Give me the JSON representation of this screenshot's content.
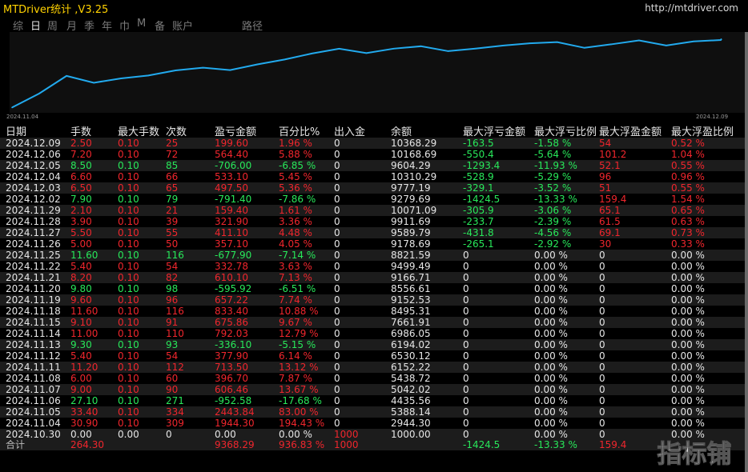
{
  "app": {
    "title": "MTDriver统计 ,V3.25",
    "url": "http://mtdriver.com"
  },
  "nav": {
    "items": [
      "综",
      "日",
      "周",
      "月",
      "季",
      "年",
      "巾",
      "M",
      "备",
      "账户",
      "路径"
    ],
    "active": "日"
  },
  "colors": {
    "profit": "#f0262d",
    "loss": "#28e85a",
    "curve": "#22aaee",
    "title": "#ffd200"
  },
  "chart_data": {
    "type": "line",
    "x_start_label": "2024.11.04",
    "x_end_label": "2024.12.09",
    "x": [
      "2024.10.30",
      "2024.11.04",
      "2024.11.05",
      "2024.11.06",
      "2024.11.07",
      "2024.11.08",
      "2024.11.11",
      "2024.11.12",
      "2024.11.13",
      "2024.11.14",
      "2024.11.15",
      "2024.11.18",
      "2024.11.19",
      "2024.11.20",
      "2024.11.21",
      "2024.11.22",
      "2024.11.25",
      "2024.11.26",
      "2024.11.27",
      "2024.11.28",
      "2024.11.29",
      "2024.12.02",
      "2024.12.03",
      "2024.12.04",
      "2024.12.05",
      "2024.12.06",
      "2024.12.09"
    ],
    "values": [
      1000.0,
      2944.3,
      5388.14,
      4435.56,
      5042.02,
      5438.72,
      6152.22,
      6530.12,
      6194.02,
      6986.05,
      7661.91,
      8495.31,
      9152.53,
      8556.61,
      9166.71,
      9499.49,
      8821.59,
      9178.69,
      9589.79,
      9911.69,
      10071.09,
      9279.69,
      9777.19,
      10310.29,
      9604.29,
      10168.69,
      10368.29
    ]
  },
  "table": {
    "headers": [
      "日期",
      "手数",
      "最大手数",
      "次数",
      "盈亏金额",
      "百分比%",
      "出入金",
      "余额",
      "最大浮亏金额",
      "最大浮亏比例",
      "最大浮盈金额",
      "最大浮盈比例"
    ],
    "rows": [
      [
        "2024.12.09",
        "2.50",
        "0.10",
        "25",
        "199.60",
        "1.96 %",
        "0",
        "10368.29",
        "-163.5",
        "-1.58 %",
        "54",
        "0.52 %"
      ],
      [
        "2024.12.06",
        "7.20",
        "0.10",
        "72",
        "564.40",
        "5.88 %",
        "0",
        "10168.69",
        "-550.4",
        "-5.64 %",
        "101.2",
        "1.04 %"
      ],
      [
        "2024.12.05",
        "8.50",
        "0.10",
        "85",
        "-706.00",
        "-6.85 %",
        "0",
        "9604.29",
        "-1293.4",
        "-11.93 %",
        "52.1",
        "0.55 %"
      ],
      [
        "2024.12.04",
        "6.60",
        "0.10",
        "66",
        "533.10",
        "5.45 %",
        "0",
        "10310.29",
        "-528.9",
        "-5.29 %",
        "96",
        "0.96 %"
      ],
      [
        "2024.12.03",
        "6.50",
        "0.10",
        "65",
        "497.50",
        "5.36 %",
        "0",
        "9777.19",
        "-329.1",
        "-3.52 %",
        "51",
        "0.55 %"
      ],
      [
        "2024.12.02",
        "7.90",
        "0.10",
        "79",
        "-791.40",
        "-7.86 %",
        "0",
        "9279.69",
        "-1424.5",
        "-13.33 %",
        "159.4",
        "1.54 %"
      ],
      [
        "2024.11.29",
        "2.10",
        "0.10",
        "21",
        "159.40",
        "1.61 %",
        "0",
        "10071.09",
        "-305.9",
        "-3.06 %",
        "65.1",
        "0.65 %"
      ],
      [
        "2024.11.28",
        "3.90",
        "0.10",
        "39",
        "321.90",
        "3.36 %",
        "0",
        "9911.69",
        "-233.7",
        "-2.39 %",
        "61.5",
        "0.63 %"
      ],
      [
        "2024.11.27",
        "5.50",
        "0.10",
        "55",
        "411.10",
        "4.48 %",
        "0",
        "9589.79",
        "-431.8",
        "-4.56 %",
        "69.1",
        "0.73 %"
      ],
      [
        "2024.11.26",
        "5.00",
        "0.10",
        "50",
        "357.10",
        "4.05 %",
        "0",
        "9178.69",
        "-265.1",
        "-2.92 %",
        "30",
        "0.33 %"
      ],
      [
        "2024.11.25",
        "11.60",
        "0.10",
        "116",
        "-677.90",
        "-7.14 %",
        "0",
        "8821.59",
        "0",
        "0.00 %",
        "0",
        "0.00 %"
      ],
      [
        "2024.11.22",
        "5.40",
        "0.10",
        "54",
        "332.78",
        "3.63 %",
        "0",
        "9499.49",
        "0",
        "0.00 %",
        "0",
        "0.00 %"
      ],
      [
        "2024.11.21",
        "8.20",
        "0.10",
        "82",
        "610.10",
        "7.13 %",
        "0",
        "9166.71",
        "0",
        "0.00 %",
        "0",
        "0.00 %"
      ],
      [
        "2024.11.20",
        "9.80",
        "0.10",
        "98",
        "-595.92",
        "-6.51 %",
        "0",
        "8556.61",
        "0",
        "0.00 %",
        "0",
        "0.00 %"
      ],
      [
        "2024.11.19",
        "9.60",
        "0.10",
        "96",
        "657.22",
        "7.74 %",
        "0",
        "9152.53",
        "0",
        "0.00 %",
        "0",
        "0.00 %"
      ],
      [
        "2024.11.18",
        "11.60",
        "0.10",
        "116",
        "833.40",
        "10.88 %",
        "0",
        "8495.31",
        "0",
        "0.00 %",
        "0",
        "0.00 %"
      ],
      [
        "2024.11.15",
        "9.10",
        "0.10",
        "91",
        "675.86",
        "9.67 %",
        "0",
        "7661.91",
        "0",
        "0.00 %",
        "0",
        "0.00 %"
      ],
      [
        "2024.11.14",
        "11.00",
        "0.10",
        "110",
        "792.03",
        "12.79 %",
        "0",
        "6986.05",
        "0",
        "0.00 %",
        "0",
        "0.00 %"
      ],
      [
        "2024.11.13",
        "9.30",
        "0.10",
        "93",
        "-336.10",
        "-5.15 %",
        "0",
        "6194.02",
        "0",
        "0.00 %",
        "0",
        "0.00 %"
      ],
      [
        "2024.11.12",
        "5.40",
        "0.10",
        "54",
        "377.90",
        "6.14 %",
        "0",
        "6530.12",
        "0",
        "0.00 %",
        "0",
        "0.00 %"
      ],
      [
        "2024.11.11",
        "11.20",
        "0.10",
        "112",
        "713.50",
        "13.12 %",
        "0",
        "6152.22",
        "0",
        "0.00 %",
        "0",
        "0.00 %"
      ],
      [
        "2024.11.08",
        "6.00",
        "0.10",
        "60",
        "396.70",
        "7.87 %",
        "0",
        "5438.72",
        "0",
        "0.00 %",
        "0",
        "0.00 %"
      ],
      [
        "2024.11.07",
        "9.00",
        "0.10",
        "90",
        "606.46",
        "13.67 %",
        "0",
        "5042.02",
        "0",
        "0.00 %",
        "0",
        "0.00 %"
      ],
      [
        "2024.11.06",
        "27.10",
        "0.10",
        "271",
        "-952.58",
        "-17.68 %",
        "0",
        "4435.56",
        "0",
        "0.00 %",
        "0",
        "0.00 %"
      ],
      [
        "2024.11.05",
        "33.40",
        "0.10",
        "334",
        "2443.84",
        "83.00 %",
        "0",
        "5388.14",
        "0",
        "0.00 %",
        "0",
        "0.00 %"
      ],
      [
        "2024.11.04",
        "30.90",
        "0.10",
        "309",
        "1944.30",
        "194.43 %",
        "0",
        "2944.30",
        "0",
        "0.00 %",
        "0",
        "0.00 %"
      ],
      [
        "2024.10.30",
        "0.00",
        "0.00",
        "0",
        "0.00",
        "0.00 %",
        "1000",
        "1000.00",
        "0",
        "0.00 %",
        "0",
        "0.00 %"
      ]
    ],
    "total": {
      "label": "合计",
      "lots": "264.30",
      "profit": "9368.29",
      "percent": "936.83 %",
      "deposit": "1000",
      "max_float_loss": "-1424.5",
      "max_float_loss_pct": "-13.33 %",
      "max_float_profit": "159.4"
    }
  },
  "watermark": {
    "text": "指标铺"
  }
}
